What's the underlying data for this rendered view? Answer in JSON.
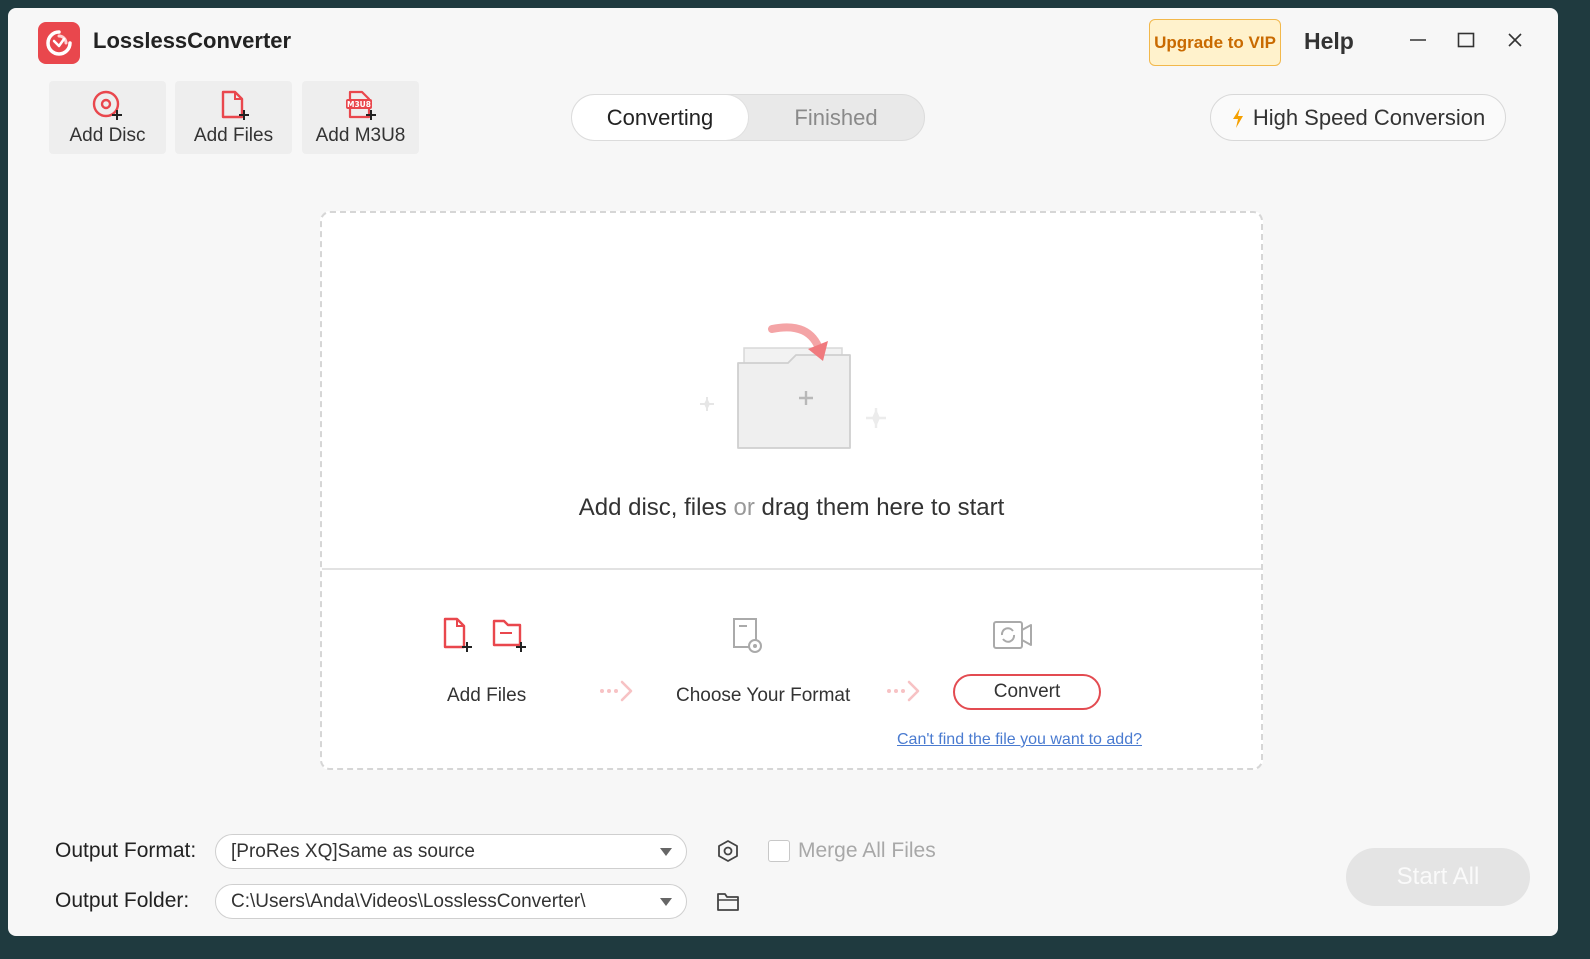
{
  "app": {
    "title": "LosslessConverter"
  },
  "titlebar": {
    "vip_label": "Upgrade to VIP",
    "help_label": "Help"
  },
  "toolbar": {
    "items": [
      {
        "label": "Add Disc",
        "icon": "add-disc-icon"
      },
      {
        "label": "Add Files",
        "icon": "add-file-icon"
      },
      {
        "label": "Add M3U8",
        "icon": "add-m3u8-icon",
        "badge": "M3U8"
      }
    ]
  },
  "tabs": [
    {
      "label": "Converting",
      "active": true
    },
    {
      "label": "Finished",
      "active": false
    }
  ],
  "high_speed": {
    "label": "High Speed Conversion"
  },
  "dropzone": {
    "text_part1": "Add disc, files",
    "text_or": "or",
    "text_part2": "drag them here to start",
    "steps": {
      "add_files": "Add Files",
      "choose_format": "Choose Your Format",
      "convert": "Convert"
    },
    "help_link": "Can't find the file you want to add?"
  },
  "output": {
    "format_label": "Output Format:",
    "format_value": "[ProRes XQ]Same as source",
    "folder_label": "Output Folder:",
    "folder_value": "C:\\Users\\Anda\\Videos\\LosslessConverter\\",
    "merge_label": "Merge All Files",
    "merge_checked": false
  },
  "start_all": {
    "label": "Start All"
  },
  "colors": {
    "accent": "#e9474d",
    "vip_bg": "#fff2cc",
    "vip_text": "#c96a00",
    "link": "#4a7bd0",
    "lightning": "#f5a000"
  }
}
